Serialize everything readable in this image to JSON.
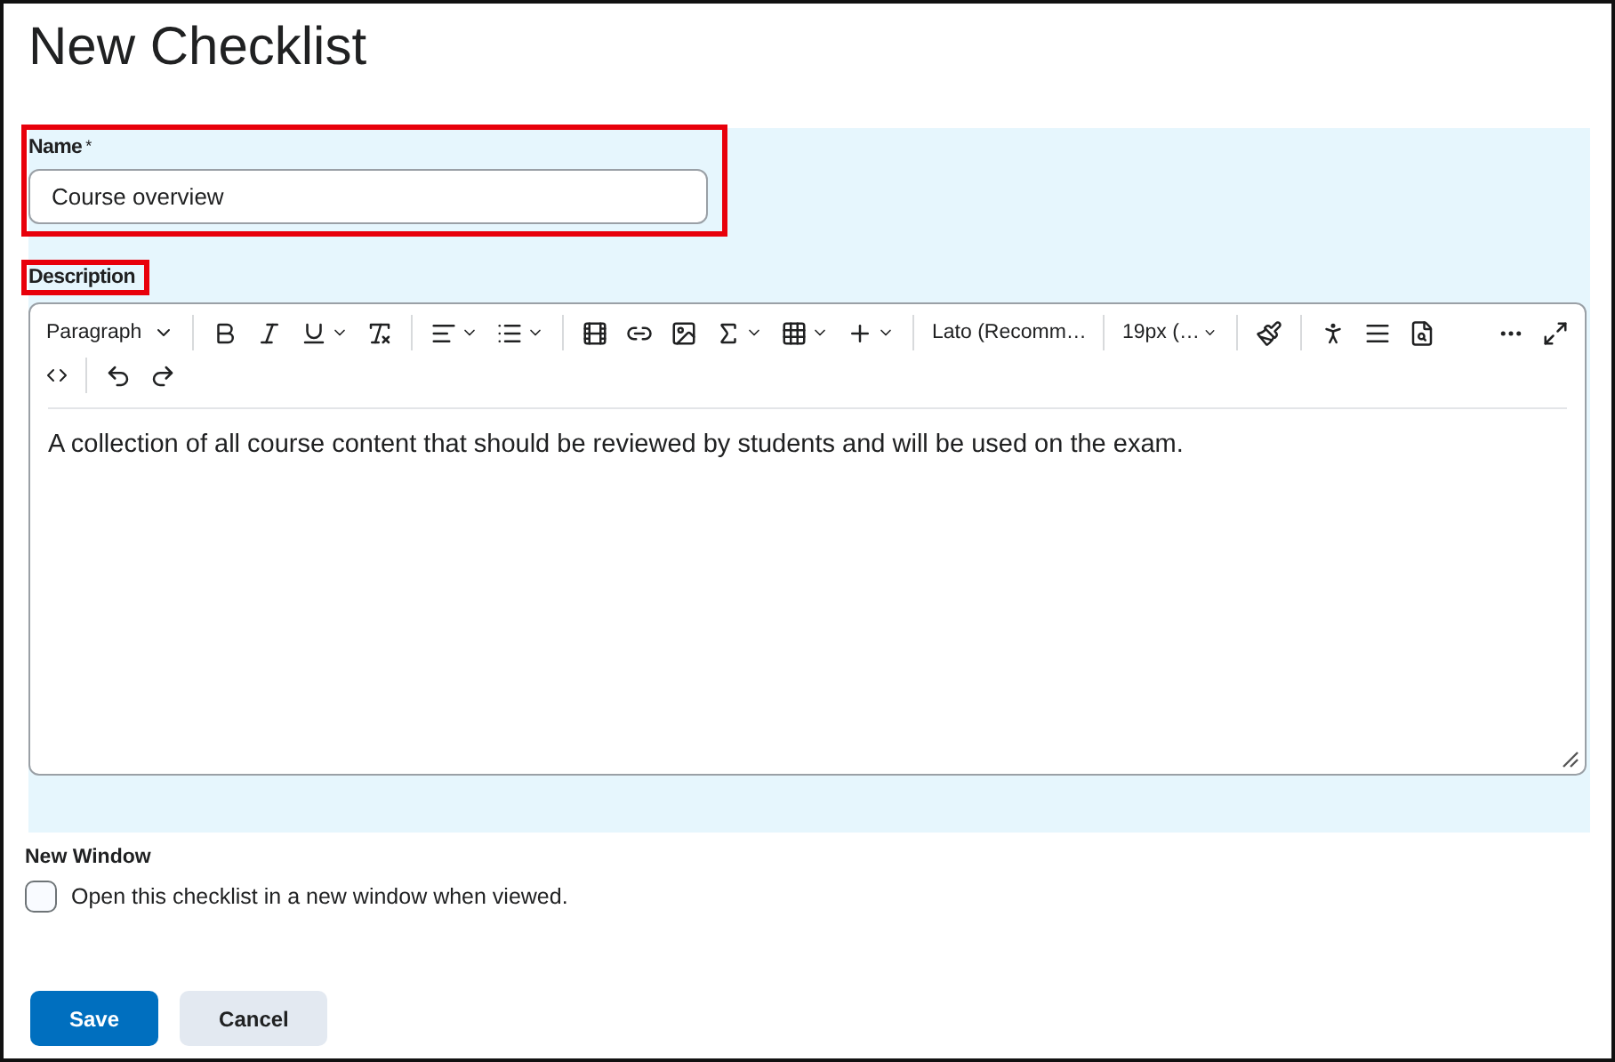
{
  "title": "New Checklist",
  "name_field": {
    "label": "Name",
    "required_mark": "*",
    "value": "Course overview",
    "highlighted": true
  },
  "description": {
    "label": "Description",
    "highlighted": true,
    "toolbar": {
      "block_format": "Paragraph",
      "font": "Lato (Recomm…",
      "size": "19px (…"
    },
    "content": "A collection of all course content that should be reviewed by students and will be used on the exam."
  },
  "new_window": {
    "label": "New Window",
    "option": "Open this checklist in a new window when viewed.",
    "checked": false
  },
  "buttons": [
    {
      "label": "Save",
      "kind": "primary"
    },
    {
      "label": "Cancel",
      "kind": "secondary"
    }
  ]
}
